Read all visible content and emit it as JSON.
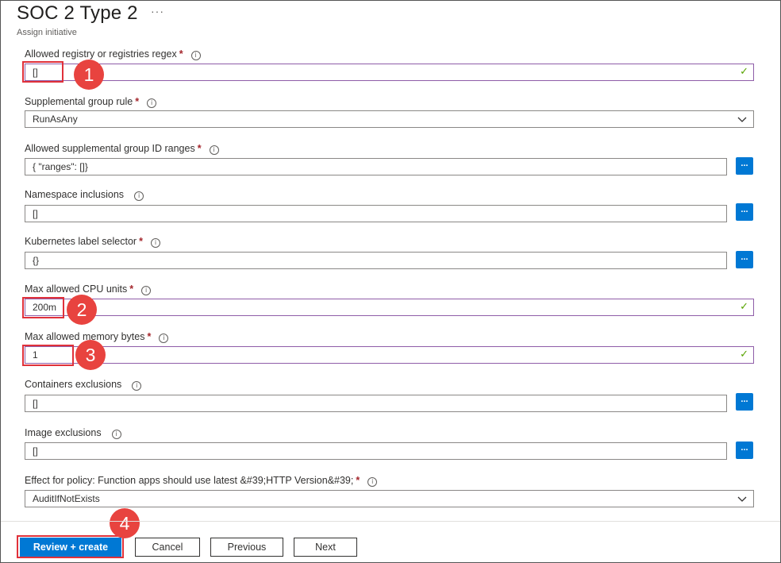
{
  "header": {
    "title": "SOC 2 Type 2",
    "more_label": "···",
    "subtitle": "Assign initiative"
  },
  "fields": [
    {
      "label": "Allowed registry or registries regex",
      "required": "*",
      "value": "[]",
      "type": "text",
      "valid": true
    },
    {
      "label": "Supplemental group rule",
      "required": "*",
      "value": "RunAsAny",
      "type": "select"
    },
    {
      "label": "Allowed supplemental group ID ranges",
      "required": "*",
      "value": "{  \"ranges\": []}",
      "type": "text-button",
      "button_label": "..."
    },
    {
      "label": "Namespace inclusions",
      "required": "",
      "value": "[]",
      "type": "text-button",
      "button_label": "..."
    },
    {
      "label": "Kubernetes label selector",
      "required": "*",
      "value": "{}",
      "type": "text-button",
      "button_label": "..."
    },
    {
      "label": "Max allowed CPU units",
      "required": "*",
      "value": "200m",
      "type": "text",
      "valid": true
    },
    {
      "label": "Max allowed memory bytes",
      "required": "*",
      "value": "1",
      "type": "text",
      "valid": true
    },
    {
      "label": "Containers exclusions",
      "required": "",
      "value": "[]",
      "type": "text-button",
      "button_label": "..."
    },
    {
      "label": "Image exclusions",
      "required": "",
      "value": "[]",
      "type": "text-button",
      "button_label": "..."
    },
    {
      "label": "Effect for policy: Function apps should use latest &#39;HTTP Version&#39;",
      "required": "*",
      "value": "AuditIfNotExists",
      "type": "select"
    }
  ],
  "icons": {
    "info": "info-icon",
    "check": "checkmark-icon",
    "chevron": "chevron-down-icon"
  },
  "info_glyph": "i",
  "check_glyph": "✓",
  "annotations": [
    "1",
    "2",
    "3",
    "4"
  ],
  "footer": {
    "review_create": "Review + create",
    "cancel": "Cancel",
    "previous": "Previous",
    "next": "Next"
  },
  "colors": {
    "accent": "#0078d4",
    "required": "#a4262c",
    "valid_check": "#57a300",
    "annotation_red": "#e8433f"
  }
}
